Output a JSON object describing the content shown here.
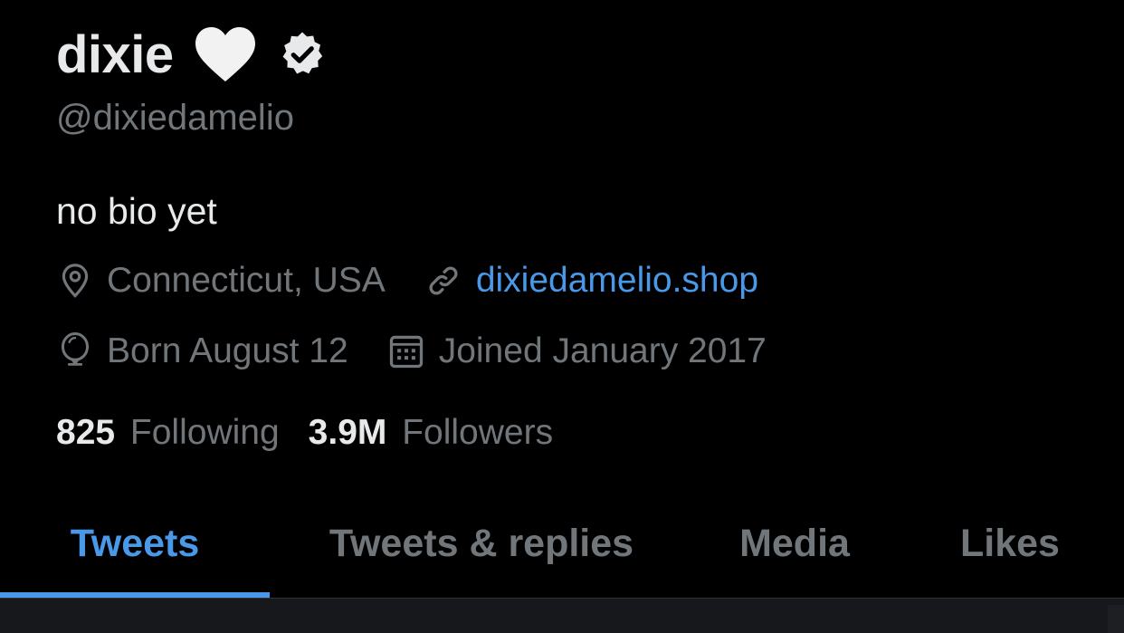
{
  "profile": {
    "display_name": "dixie",
    "handle": "@dixiedamelio",
    "bio": "no bio yet",
    "location": "Connecticut, USA",
    "website": "dixiedamelio.shop",
    "birthday": "Born August 12",
    "joined": "Joined January 2017",
    "following_count": "825",
    "following_label": "Following",
    "followers_count": "3.9M",
    "followers_label": "Followers"
  },
  "icons": {
    "name_emoji": "white-heart-icon",
    "verified": "verified-badge-icon",
    "location": "location-pin-icon",
    "link": "link-icon",
    "birthday": "balloon-icon",
    "joined": "calendar-icon"
  },
  "tabs": [
    {
      "label": "Tweets",
      "active": true
    },
    {
      "label": "Tweets & replies",
      "active": false
    },
    {
      "label": "Media",
      "active": false
    },
    {
      "label": "Likes",
      "active": false
    }
  ],
  "colors": {
    "background": "#000000",
    "primary_text": "#e7e9ea",
    "secondary_text": "#71767b",
    "accent": "#4a99e9"
  }
}
